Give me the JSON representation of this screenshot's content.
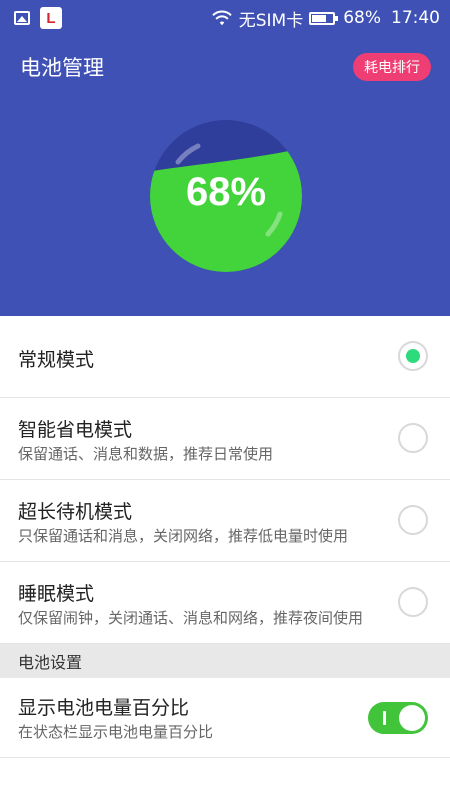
{
  "status_bar": {
    "sim_text": "无SIM卡",
    "battery_text": "68%",
    "battery_level": 0.68,
    "time": "17:40",
    "icons": [
      "image-icon",
      "le-app-icon",
      "wifi-icon",
      "battery-icon"
    ]
  },
  "header": {
    "title": "电池管理",
    "rank_button": "耗电排行",
    "gauge": {
      "value_text": "68%",
      "level": 0.68,
      "fill_color": "#43d43b",
      "empty_color": "#2f3d9b"
    },
    "background_color": "#3f51b5",
    "button_color": "#ef3e73"
  },
  "modes": [
    {
      "title": "常规模式",
      "subtitle": "",
      "selected": true
    },
    {
      "title": "智能省电模式",
      "subtitle": "保留通话、消息和数据，推荐日常使用",
      "selected": false
    },
    {
      "title": "超长待机模式",
      "subtitle": "只保留通话和消息，关闭网络，推荐低电量时使用",
      "selected": false
    },
    {
      "title": "睡眠模式",
      "subtitle": "仅保留闹钟，关闭通话、消息和网络，推荐夜间使用",
      "selected": false
    }
  ],
  "settings": {
    "section_title": "电池设置",
    "items": [
      {
        "title": "显示电池电量百分比",
        "subtitle": "在状态栏显示电池电量百分比",
        "enabled": true
      }
    ]
  },
  "colors": {
    "accent_green": "#2ddb7c",
    "toggle_green": "#41c43a"
  }
}
